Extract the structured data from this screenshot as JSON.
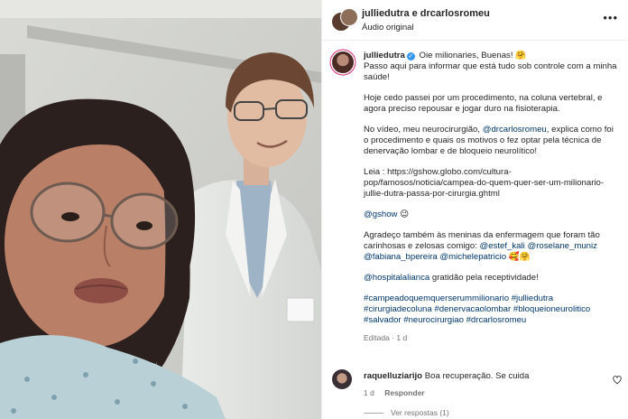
{
  "header": {
    "names": "julliedutra e drcarlosromeu",
    "audio": "Áudio original",
    "more": "•••"
  },
  "caption": {
    "username": "julliedutra",
    "greeting": "Oie milionaries, Buenas! 🤗",
    "p1": "Passo aqui para informar que está tudo sob controle com a minha saúde!",
    "p2": "Hoje cedo passei por um procedimento, na coluna vertebral, e agora preciso repousar e jogar duro na fisioterapia.",
    "p3_a": "No vídeo, meu neurocirurgião, ",
    "p3_mention": "@drcarlosromeu",
    "p3_b": ", explica como foi o procedimento e quais os motivos o fez optar pela técnica de denervação lombar e de bloqueio neurolítico!",
    "p4_label": "Leia : ",
    "p4_link": "https://gshow.globo.com/cultura-pop/famosos/noticia/campea-do-quem-quer-ser-um-milionario-jullie-dutra-passa-por-cirurgia.ghtml",
    "p5_mention": "@gshow",
    "p5_emoji": " 😉",
    "p6_a": "Agradeço também às meninas da enfermagem que foram tão carinhosas e zelosas comigo: ",
    "p6_m1": "@estef_kali",
    "p6_m2": "@roselane_muniz",
    "p6_m3": "@fabiana_bpereira",
    "p6_m4": "@michelepatricio",
    "p6_emoji": " 🥰🤗",
    "p7_mention": "@hospitalalianca",
    "p7_text": " gratidão pela receptividade!",
    "hashtags": "#campeadoquemquerserummilionario #julliedutra #cirurgiadecoluna #denervacaolombar #bloqueioneurolitico #salvador #neurocirurgiao #drcarlosromeu",
    "meta": "Editada · 1 d"
  },
  "comment": {
    "username": "raquelluziarijo",
    "text": " Boa recuperação. Se cuida",
    "time": "1 d",
    "reply": "Responder",
    "view_replies": "Ver respostas (1)"
  },
  "colors": {
    "link": "#00376b",
    "verified": "#3897f0",
    "muted": "#737373"
  }
}
